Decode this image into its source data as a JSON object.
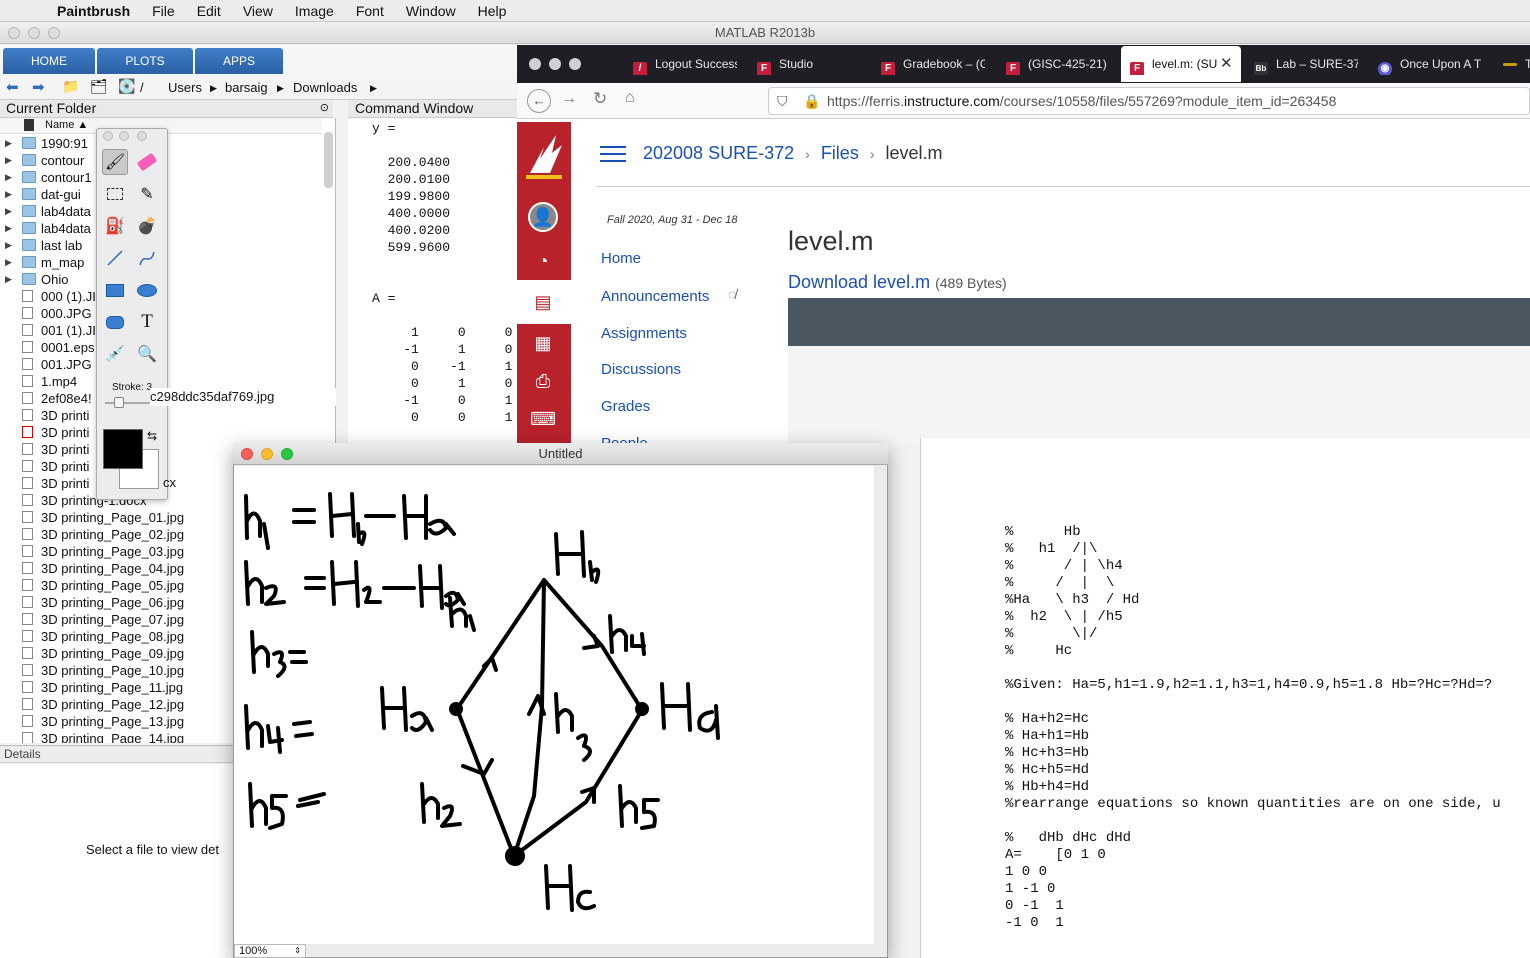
{
  "menubar": {
    "app": "Paintbrush",
    "items": [
      "File",
      "Edit",
      "View",
      "Image",
      "Font",
      "Window",
      "Help"
    ]
  },
  "matlab": {
    "title": "MATLAB R2013b",
    "tabs": [
      "HOME",
      "PLOTS",
      "APPS"
    ],
    "path": [
      "/",
      "Users",
      "barsaig",
      "Downloads"
    ],
    "current_folder_label": "Current Folder",
    "name_col": "Name ▲",
    "files": [
      {
        "name": "1990:91",
        "type": "folder"
      },
      {
        "name": "contour",
        "type": "folder"
      },
      {
        "name": "contour1",
        "type": "folder"
      },
      {
        "name": "dat-gui",
        "type": "folder"
      },
      {
        "name": "lab4data",
        "type": "folder"
      },
      {
        "name": "lab4data",
        "type": "folder"
      },
      {
        "name": "last lab",
        "type": "folder"
      },
      {
        "name": "m_map",
        "type": "folder"
      },
      {
        "name": "Ohio",
        "type": "folder"
      },
      {
        "name": "000 (1).JI",
        "type": "file"
      },
      {
        "name": "000.JPG",
        "type": "file"
      },
      {
        "name": "001 (1).JI",
        "type": "file"
      },
      {
        "name": "0001.eps",
        "type": "file"
      },
      {
        "name": "001.JPG",
        "type": "file"
      },
      {
        "name": "1.mp4",
        "type": "file"
      },
      {
        "name": "2ef08e4!",
        "type": "file",
        "suffix": "c298ddc35daf769.jpg"
      },
      {
        "name": "3D printi",
        "type": "file"
      },
      {
        "name": "3D printi",
        "type": "pdf"
      },
      {
        "name": "3D printi",
        "type": "file"
      },
      {
        "name": "3D printi",
        "type": "file"
      },
      {
        "name": "3D printi",
        "type": "file",
        "suffix": "cx"
      },
      {
        "name": "3D printing-1.docx",
        "type": "file"
      },
      {
        "name": "3D printing_Page_01.jpg",
        "type": "file"
      },
      {
        "name": "3D printing_Page_02.jpg",
        "type": "file"
      },
      {
        "name": "3D printing_Page_03.jpg",
        "type": "file"
      },
      {
        "name": "3D printing_Page_04.jpg",
        "type": "file"
      },
      {
        "name": "3D printing_Page_05.jpg",
        "type": "file"
      },
      {
        "name": "3D printing_Page_06.jpg",
        "type": "file"
      },
      {
        "name": "3D printing_Page_07.jpg",
        "type": "file"
      },
      {
        "name": "3D printing_Page_08.jpg",
        "type": "file"
      },
      {
        "name": "3D printing_Page_09.jpg",
        "type": "file"
      },
      {
        "name": "3D printing_Page_10.jpg",
        "type": "file"
      },
      {
        "name": "3D printing_Page_11.jpg",
        "type": "file"
      },
      {
        "name": "3D printing_Page_12.jpg",
        "type": "file"
      },
      {
        "name": "3D printing_Page_13.jpg",
        "type": "file"
      },
      {
        "name": "3D printing_Page_14.jpg",
        "type": "file"
      }
    ],
    "details_label": "Details",
    "details_text": "Select a file to view det",
    "command_window_label": "Command Window",
    "command_output": "y =\n\n  200.0400\n  200.0100\n  199.9800\n  400.0000\n  400.0200\n  599.9600\n\n\nA =\n\n     1     0     0\n    -1     1     0\n     0    -1     1\n     0     1     0\n    -1     0     1\n     0     0     1"
  },
  "palette": {
    "stroke_label": "Stroke: 3",
    "stroke_value": 3,
    "primary_color": "#000000",
    "secondary_color": "#ffffff"
  },
  "browser": {
    "tabs": [
      {
        "label": "Logout Success",
        "icon": "canvas-icon"
      },
      {
        "label": "Studio",
        "icon": "ferris-icon"
      },
      {
        "label": "Gradebook – (G",
        "icon": "ferris-icon"
      },
      {
        "label": "(GISC-425-21)",
        "icon": "ferris-icon"
      },
      {
        "label": "level.m: (SU",
        "icon": "ferris-icon",
        "active": true
      },
      {
        "label": "Lab – SURE-37",
        "icon": "blackboard-icon"
      },
      {
        "label": "Once Upon A T",
        "icon": "bookmark-icon"
      },
      {
        "label": "T",
        "icon": "generic-icon"
      }
    ],
    "url_host_prefix": "https://ferris.",
    "url_host": "instructure.com",
    "url_path": "/courses/10558/files/557269?module_item_id=263458",
    "breadcrumb": [
      "202008 SURE-372",
      "Files",
      "level.m"
    ],
    "term": "Fall 2020, Aug 31 - Dec 18",
    "nav": [
      "Home",
      "Announcements",
      "Assignments",
      "Discussions",
      "Grades",
      "People"
    ],
    "file_title": "level.m",
    "download_link": "Download level.m",
    "file_size": "(489 Bytes)",
    "code": "%      Hb\n%   h1  /|\\\n%      / | \\h4\n%     /  |  \\\n%Ha   \\ h3  / Hd\n%  h2  \\ | /h5\n%       \\|/\n%     Hc\n\n%Given: Ha=5,h1=1.9,h2=1.1,h3=1,h4=0.9,h5=1.8 Hb=?Hc=?Hd=?\n\n% Ha+h2=Hc\n% Ha+h1=Hb\n% Hc+h3=Hb\n% Hc+h5=Hd\n% Hb+h4=Hd\n%rearrange equations so known quantities are on one side, u\n\n%   dHb dHc dHd\nA=    [0 1 0\n1 0 0\n1 -1 0\n0 -1  1\n-1 0  1"
  },
  "paint_window": {
    "title": "Untitled",
    "zoom": "100%",
    "drawing_labels": [
      "h₁ = H_b − H_a",
      "h₂ = H_c − H_a",
      "h₃ =",
      "h₄ =",
      "h₅ =",
      "H_a",
      "H_b",
      "H_c",
      "H_d",
      "h₁",
      "h₂",
      "h₃",
      "h₄",
      "h₅"
    ]
  }
}
